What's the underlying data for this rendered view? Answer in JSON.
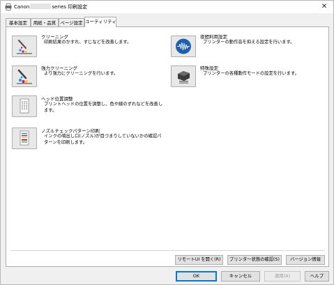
{
  "window": {
    "title_prefix": "Canon",
    "title_suffix": "series 印刷設定",
    "close_glyph": "✕"
  },
  "tabs": [
    {
      "label": "基本設定",
      "active": false
    },
    {
      "label": "用紙・品質",
      "active": false
    },
    {
      "label": "ページ設定",
      "active": false
    },
    {
      "label": "ユーティリティ",
      "active": true
    }
  ],
  "functions": [
    {
      "title": "クリーニング",
      "desc": "印刷結果のかすれ、すじなどを改善します。",
      "icon": "cleaning-icon"
    },
    {
      "title": "強力クリーニング",
      "desc": "より強力にクリーニングを行います。",
      "icon": "deep-cleaning-icon"
    },
    {
      "title": "ヘッド位置調整",
      "desc": "プリントヘッドの位置を調整し、色や線のずれなどを改善します。",
      "icon": "head-alignment-icon"
    },
    {
      "title": "ノズルチェックパターン印刷",
      "desc": "インクの噴出し口(ノズル)が目づまりしていないかの確認パターンを印刷します。",
      "icon": "nozzle-check-icon"
    },
    {
      "title": "夜間利用設定",
      "desc": "プリンターの動作音を抑える設定を行います。",
      "icon": "quiet-mode-icon"
    },
    {
      "title": "特殊設定",
      "desc": "プリンターの各種動作モードの設定を行います。",
      "icon": "special-settings-icon"
    }
  ],
  "panel_buttons": {
    "remote_ui": "リモートUI を開く(R)",
    "printer_status": "プリンター状態の確認(S)",
    "version_info": "バージョン情報"
  },
  "dialog_buttons": {
    "ok": "OK",
    "cancel": "キャンセル",
    "apply": "適用(A)",
    "help": "ヘルプ"
  },
  "colors": {
    "accent": "#0078d7",
    "quiet_mode_blue": "#1f5fb0"
  }
}
